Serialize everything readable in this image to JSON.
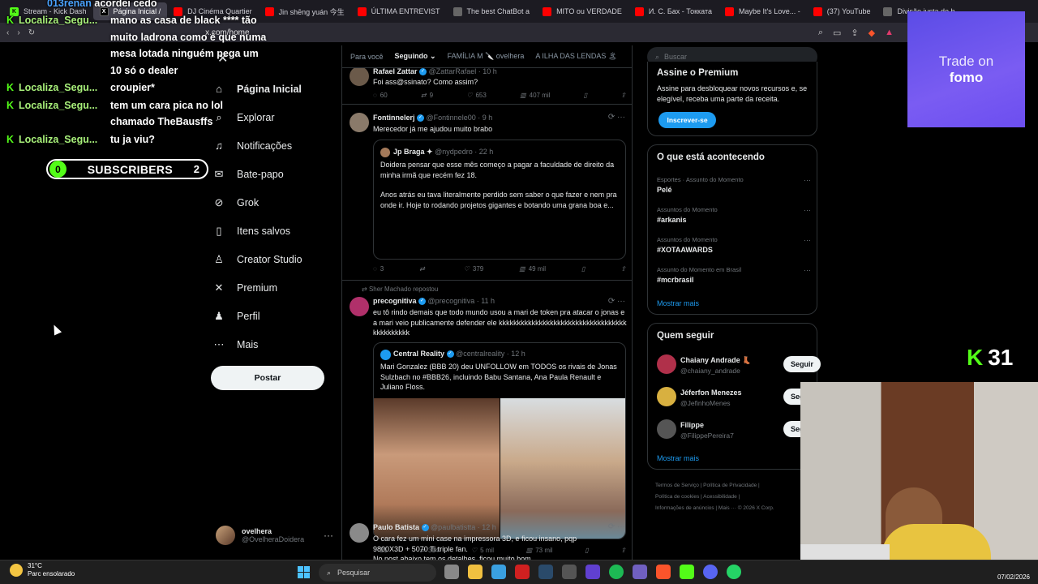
{
  "browser": {
    "tabs": [
      {
        "label": "Stream - Kick Dash",
        "icon": "kick"
      },
      {
        "label": "Página Inicial /",
        "icon": "x",
        "active": true
      },
      {
        "label": "DJ Cinéma Quartier",
        "icon": "youtube"
      },
      {
        "label": "Jin shēng yuán 今生",
        "icon": "youtube"
      },
      {
        "label": "ÚLTIMA ENTREVIST",
        "icon": "youtube"
      },
      {
        "label": "The best ChatBot a",
        "icon": "generic"
      },
      {
        "label": "MITO ou VERDADE",
        "icon": "youtube"
      },
      {
        "label": "И. С. Бах - Токката",
        "icon": "youtube"
      },
      {
        "label": "Maybe It's Love... -",
        "icon": "youtube"
      },
      {
        "label": "(37) YouTube",
        "icon": "youtube"
      },
      {
        "label": "Divisão justa de b",
        "icon": "generic"
      }
    ],
    "url": "x.com/home"
  },
  "stream_overlay": {
    "chat": {
      "top_user": "013renan",
      "top_msg": "acordei cedo",
      "lines": [
        {
          "user": "Localiza_Segu...",
          "msg": "mano as casa de black **** tão"
        },
        {
          "user": "",
          "msg": "muito ladrona como é que numa"
        },
        {
          "user": "",
          "msg": "mesa lotada ninguém pega um"
        },
        {
          "user": "",
          "msg": "10 só o dealer"
        },
        {
          "user": "Localiza_Segu...",
          "msg": "croupier*"
        },
        {
          "user": "Localiza_Segu...",
          "msg": "tem um cara pica no lol"
        },
        {
          "user": "",
          "msg": "chamado TheBausffs"
        },
        {
          "user": "Localiza_Segu...",
          "msg": "tu ja viu?"
        }
      ]
    },
    "subscribers": {
      "left_count": "0",
      "label": "SUBSCRIBERS",
      "right_count": "2"
    },
    "sponsor": {
      "line1": "Trade on",
      "line2": "fomo"
    },
    "kick_counter": "31"
  },
  "nav": {
    "items": [
      {
        "label": "Página Inicial",
        "icon": "home-icon",
        "active": true
      },
      {
        "label": "Explorar",
        "icon": "search-icon"
      },
      {
        "label": "Notificações",
        "icon": "bell-icon"
      },
      {
        "label": "Bate-papo",
        "icon": "chat-icon"
      },
      {
        "label": "Grok",
        "icon": "grok-icon"
      },
      {
        "label": "Itens salvos",
        "icon": "bookmark-icon"
      },
      {
        "label": "Creator Studio",
        "icon": "creator-icon"
      },
      {
        "label": "Premium",
        "icon": "x-logo-icon"
      },
      {
        "label": "Perfil",
        "icon": "person-icon"
      },
      {
        "label": "Mais",
        "icon": "more-icon"
      }
    ],
    "post_label": "Postar",
    "account": {
      "name": "ovelhera",
      "handle": "@OvelheraDoidera"
    }
  },
  "timeline": {
    "tabs": [
      "Para você",
      "Seguindo",
      "FAMÍLIA M 🔪 ovelhera",
      "A ILHA DAS LENDAS 🏝"
    ],
    "posts": [
      {
        "name": "Rafael Zattar",
        "handle": "@ZattarRafael",
        "time": "10 h",
        "text": "Foi ass@ssinato? Como assim?",
        "replies": "60",
        "reposts": "9",
        "likes": "653",
        "views": "407 mil"
      },
      {
        "name": "Fontinnelerj",
        "handle": "@Fontinnele00",
        "time": "9 h",
        "text": "Merecedor já me ajudou muito brabo",
        "quote": {
          "name": "Jp Braga ✦",
          "handle": "@nydpedro",
          "time": "22 h",
          "text1": "Doidera pensar que esse mês começo a pagar a faculdade de direito da minha irmã que recém fez 18.",
          "text2": "Anos atrás eu tava literalmente perdido sem saber o que fazer e nem pra onde ir. Hoje to rodando projetos gigantes e botando uma grana boa e..."
        },
        "replies": "3",
        "reposts": "",
        "likes": "379",
        "views": "49 mil"
      },
      {
        "reposted_by": "Sher Machado repostou",
        "name": "precognitiva",
        "handle": "@precognitiva",
        "time": "11 h",
        "text": "eu tô rindo demais que todo mundo usou a mari de token pra atacar o jonas e a mari veio publicamente defender ele kkkkkkkkkkkkkkkkkkkkkkkkkkkkkkkkkkkkkkkkkkkkk",
        "quote": {
          "name": "Central Reality",
          "handle": "@centralreality",
          "time": "12 h",
          "text1": "Mari Gonzalez (BBB 20) deu UNFOLLOW em TODOS os rivais de Jonas Sulzbach no #BBB26, incluindo Babu Santana, Ana Paula Renault e Juliano Floss."
        },
        "replies": "21",
        "reposts": "314",
        "likes": "5 mil",
        "views": "73 mil"
      },
      {
        "name": "Paulo Batista",
        "handle": "@paulbatistta",
        "time": "12 h",
        "text": "O cara fez um mini case na impressora 3D, e ficou insano, pqp 9800X3D + 5070 Ti triple fan.",
        "text_cut": "No post abaixo tem os detalhes, ficou muito bom"
      }
    ]
  },
  "right": {
    "search_placeholder": "Buscar",
    "premium": {
      "title": "Assine o Premium",
      "desc": "Assine para desbloquear novos recursos e, se elegível, receba uma parte da receita.",
      "button": "Inscrever-se"
    },
    "trends": {
      "title": "O que está acontecendo",
      "items": [
        {
          "cat": "Esportes · Assunto do Momento",
          "name": "Pelé"
        },
        {
          "cat": "Assuntos do Momento",
          "name": "#arkanis"
        },
        {
          "cat": "Assuntos do Momento",
          "name": "#XOTAAWARDS"
        },
        {
          "cat": "Assunto do Momento em Brasil",
          "name": "#mcrbrasil"
        }
      ],
      "more": "Mostrar mais"
    },
    "who": {
      "title": "Quem seguir",
      "items": [
        {
          "name": "Chaiany Andrade 👢",
          "handle": "@chaiany_andrade"
        },
        {
          "name": "Jéferfon Menezes",
          "handle": "@JefinhoMenes"
        },
        {
          "name": "Filippe",
          "handle": "@FilippePereira7"
        }
      ],
      "follow_label": "Seguir",
      "more": "Mostrar mais"
    },
    "footer": {
      "l1": "Termos de Serviço | Política de Privacidade |",
      "l2": "Política de cookies | Acessibilidade |",
      "l3": "Informações de anúncios | Mais ··· © 2026 X Corp."
    }
  },
  "taskbar": {
    "weather_temp": "31°C",
    "weather_desc": "Parc ensolarado",
    "search_label": "Pesquisar",
    "date": "07/02/2026"
  }
}
